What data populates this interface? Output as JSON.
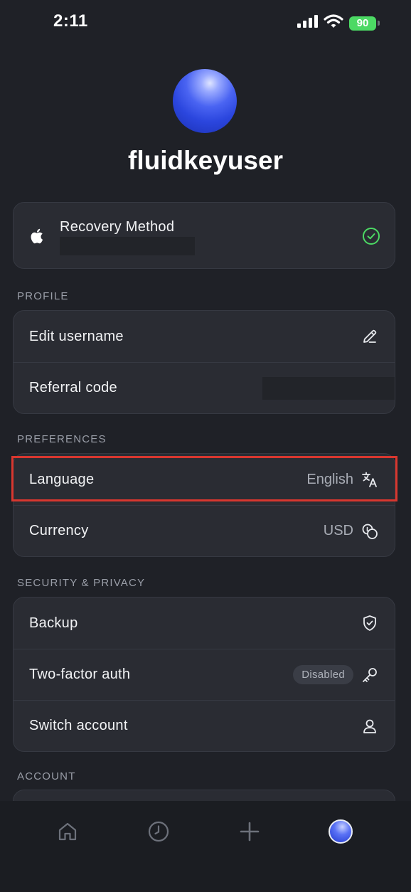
{
  "status_bar": {
    "time": "2:11",
    "battery_level": "90"
  },
  "profile": {
    "username": "fluidkeyuser"
  },
  "recovery": {
    "label": "Recovery Method",
    "status_icon": "check-circle-icon"
  },
  "sections": {
    "profile": "PROFILE",
    "preferences": "PREFERENCES",
    "security": "SECURITY & PRIVACY",
    "account": "ACCOUNT"
  },
  "profile_items": {
    "edit_username": "Edit username",
    "referral_code": "Referral code"
  },
  "preferences_items": {
    "language_label": "Language",
    "language_value": "English",
    "currency_label": "Currency",
    "currency_value": "USD"
  },
  "security_items": {
    "backup": "Backup",
    "two_factor": "Two-factor auth",
    "two_factor_status": "Disabled",
    "switch_account": "Switch account"
  },
  "nav": {
    "items": [
      "home-icon",
      "history-icon",
      "add-icon",
      "profile-avatar"
    ]
  },
  "colors": {
    "accent_green": "#4cd964",
    "highlight_red": "#d8372f",
    "background": "#1f2127",
    "card": "#2a2c33"
  }
}
